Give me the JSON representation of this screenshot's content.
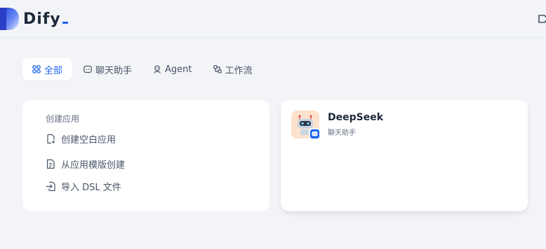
{
  "brand": {
    "name": "Dify",
    "accent": "#1c64f2"
  },
  "tabs": [
    {
      "label": "全部",
      "icon": "grid-icon",
      "active": true
    },
    {
      "label": "聊天助手",
      "icon": "chat-bubble-icon",
      "active": false
    },
    {
      "label": "Agent",
      "icon": "robot-icon",
      "active": false
    },
    {
      "label": "工作流",
      "icon": "workflow-icon",
      "active": false
    }
  ],
  "create": {
    "title": "创建应用",
    "blank_label": "创建空白应用",
    "template_label": "从应用模版创建",
    "import_label": "导入 DSL 文件"
  },
  "app": {
    "name": "DeepSeek",
    "type": "聊天助手",
    "avatar_icon": "robot-avatar-icon",
    "badge_icon": "chat-badge-icon"
  }
}
